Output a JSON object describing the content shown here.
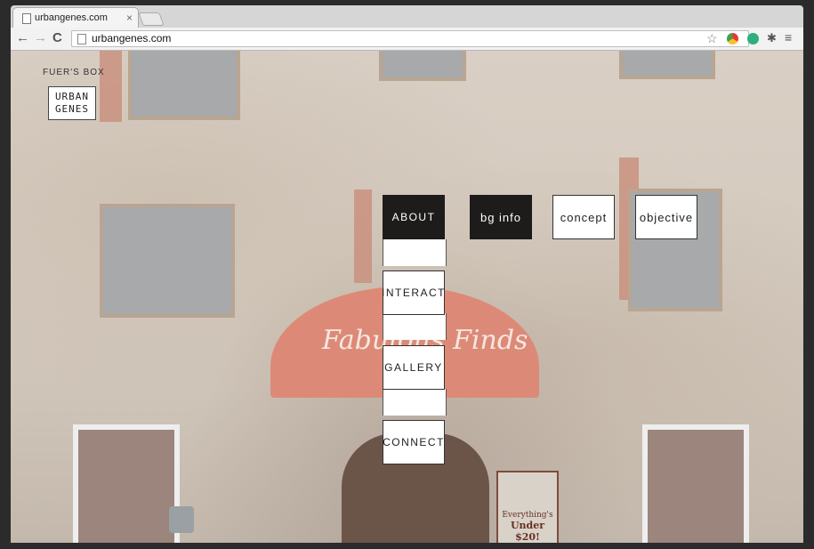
{
  "browser": {
    "tab_title": "urbangenes.com",
    "tab_close": "×",
    "url": "urbangenes.com",
    "back": "←",
    "forward": "→",
    "reload": "C",
    "star": "☆",
    "ext_puzzle": "✱",
    "menu": "≡"
  },
  "site": {
    "brand_label": "FUER'S BOX",
    "logo_line1": "URBAN",
    "logo_line2": "GENES",
    "nav": {
      "about": "ABOUT",
      "bg_info": "bg info",
      "concept": "concept",
      "objective": "objective",
      "interact": "INTERACT",
      "gallery": "GALLERY",
      "connect": "CONNECT"
    }
  },
  "background": {
    "awning_text": "Fabulous Finds",
    "sign_line1": "Everything's",
    "sign_line2": "Under $20!"
  }
}
